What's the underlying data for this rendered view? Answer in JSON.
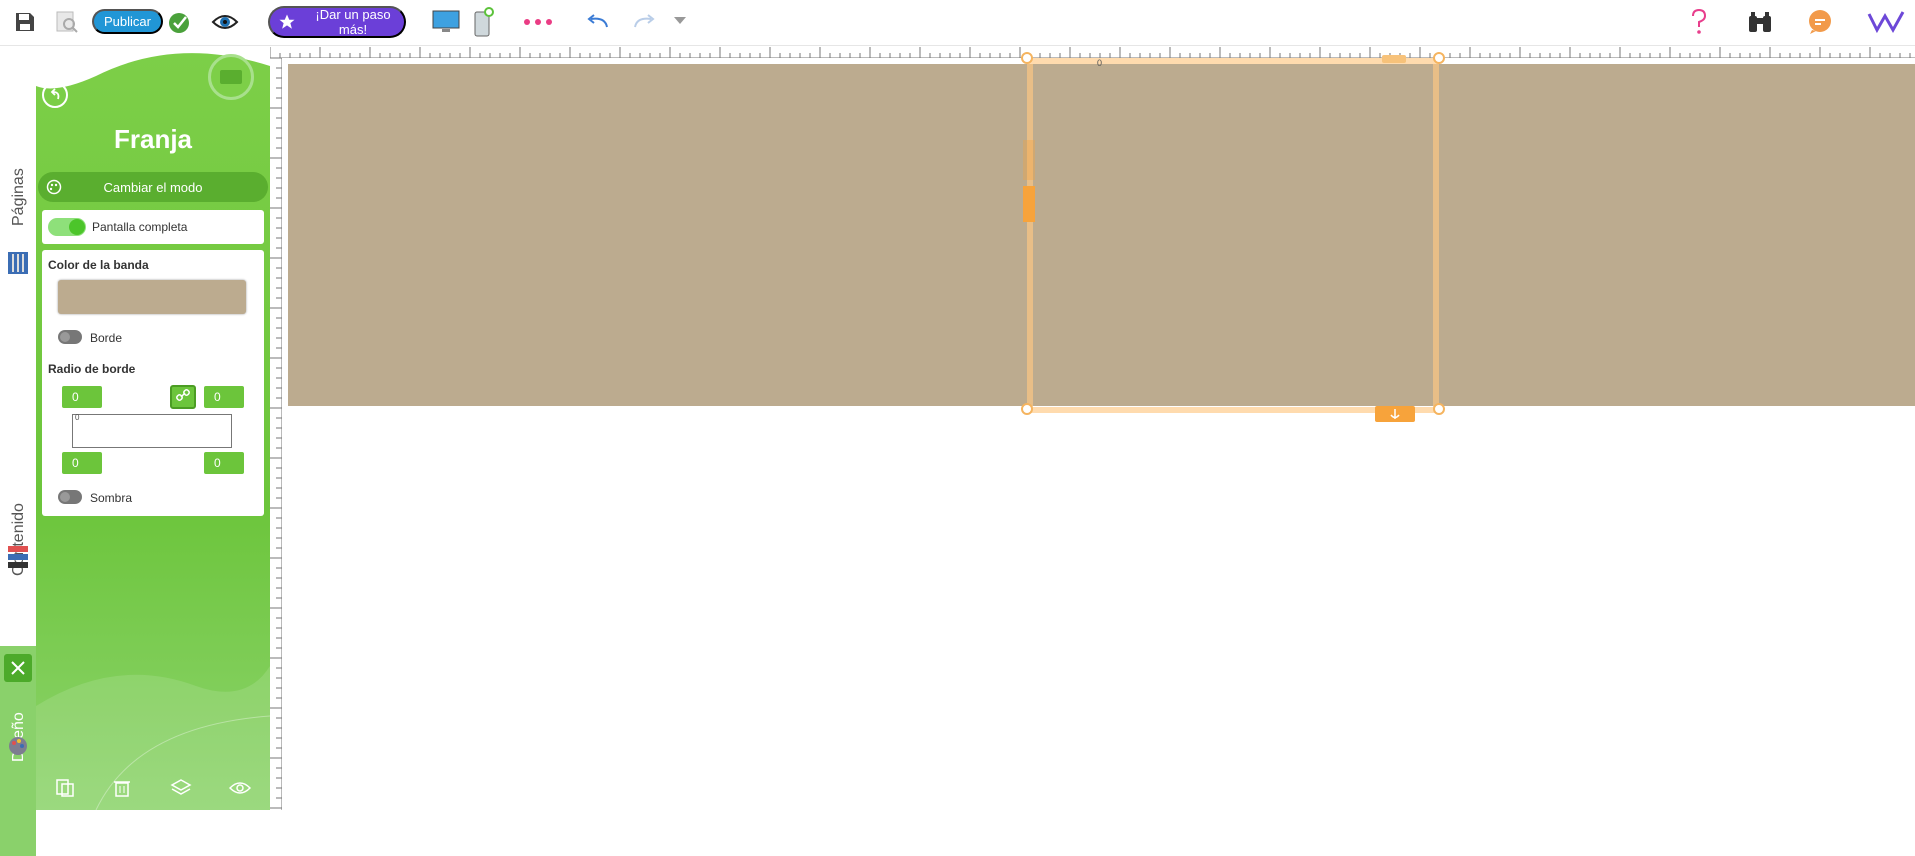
{
  "toolbar": {
    "publish_label": "Publicar",
    "upgrade_label": "¡Dar un paso más!",
    "icons": [
      "save-icon",
      "preview-search-icon",
      "publish-status-icon",
      "eye-icon",
      "desktop-icon",
      "mobile-icon",
      "more-dots-icon",
      "undo-icon",
      "redo-icon",
      "history-dropdown-icon",
      "help-icon",
      "binoculars-icon",
      "chat-icon",
      "logo-icon"
    ]
  },
  "left_tabs": {
    "pages_label": "Páginas",
    "content_label": "Contenido",
    "design_label": "Diseño"
  },
  "panel": {
    "title": "Franja",
    "mode_button_label": "Cambiar el modo",
    "fullscreen_label": "Pantalla completa",
    "fullscreen_enabled": true,
    "band_color_label": "Color de la banda",
    "band_color": "#bcab8f",
    "border_label": "Borde",
    "border_enabled": false,
    "radius_label": "Radio de borde",
    "radius_top_left": "0",
    "radius_top_right": "0",
    "radius_bottom_left": "0",
    "radius_bottom_right": "0",
    "radius_preview_value": "0",
    "shadow_label": "Sombra",
    "shadow_enabled": false
  },
  "colors": {
    "accent_green": "#6cc53b",
    "publish_blue": "#2196d6",
    "upgrade_purple": "#6b3fd8",
    "selection_orange": "#f7a33b",
    "band": "#bcab8f"
  },
  "canvas": {
    "ruler_marker": "0"
  }
}
